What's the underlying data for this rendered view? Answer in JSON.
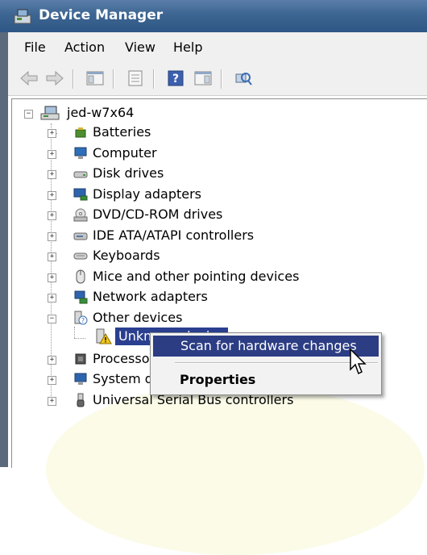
{
  "window": {
    "title": "Device Manager"
  },
  "menu": {
    "items": [
      "File",
      "Action",
      "View",
      "Help"
    ]
  },
  "toolbar": {
    "icons": [
      "back-arrow",
      "forward-arrow",
      "show-hide-console-tree",
      "properties",
      "help",
      "action-pane",
      "scan-hardware"
    ]
  },
  "tree": {
    "root": "jed-w7x64",
    "items": [
      "Batteries",
      "Computer",
      "Disk drives",
      "Display adapters",
      "DVD/CD-ROM drives",
      "IDE ATA/ATAPI controllers",
      "Keyboards",
      "Mice and other pointing devices",
      "Network adapters",
      "Other devices",
      "Processors",
      "System devices",
      "Universal Serial Bus controllers"
    ],
    "selected_child": "Unknown device",
    "processor_partial": "Processor",
    "system_partial": "System de"
  },
  "context_menu": {
    "scan": "Scan for hardware changes",
    "properties": "Properties"
  },
  "colors": {
    "selection": "#2a3f8f",
    "title_bar": "#3d6592",
    "highlight_glow": "#fbfbe8"
  }
}
